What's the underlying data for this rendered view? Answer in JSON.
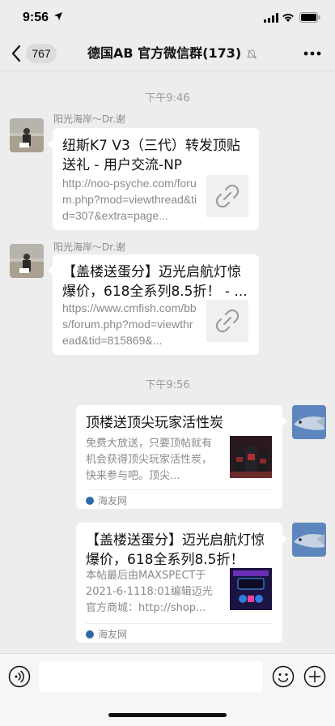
{
  "status_bar": {
    "time": "9:56"
  },
  "nav": {
    "back_count": "767",
    "title": "德国AB  官方微信群(173)"
  },
  "messages": [
    {
      "time_label": "下午9:46",
      "sender": "阳光海岸～Dr.谢",
      "title": "纽斯K7 V3（三代）转发顶贴送礼 - 用户交流-NP",
      "url": "http://noo-psyche.com/forum.php?mod=viewthread&tid=307&extra=page..."
    },
    {
      "sender": "阳光海岸～Dr.谢",
      "title": "【盖楼送蛋分】迈光启航灯惊爆价，618全系列8.5折！ - ...",
      "url": "https://www.cmfish.com/bbs/forum.php?mod=viewthread&tid=815869&..."
    },
    {
      "time_label": "下午9:56",
      "title": "顶楼送顶尖玩家活性炭",
      "desc": "免费大放送，只要顶帖就有机会获得顶尖玩家活性炭，快来参与吧。顶尖...",
      "source": "海友网"
    },
    {
      "title": "【盖楼送蛋分】迈光启航灯惊爆价，618全系列8.5折！",
      "desc": "本帖最后由MAXSPECT于2021-6-1118:01编辑迈光官方商城：http://shop...",
      "source": "海友网"
    }
  ],
  "input": {
    "value": ""
  },
  "colors": {
    "background": "#ededed",
    "bubble": "#ffffff",
    "meta_text": "#8a8a8a"
  },
  "icons": {
    "back": "chevron-left-icon",
    "mute": "bell-slash-icon",
    "more": "ellipsis-icon",
    "link": "link-icon",
    "voice": "voice-icon",
    "emoji": "emoji-icon",
    "plus": "plus-icon"
  }
}
